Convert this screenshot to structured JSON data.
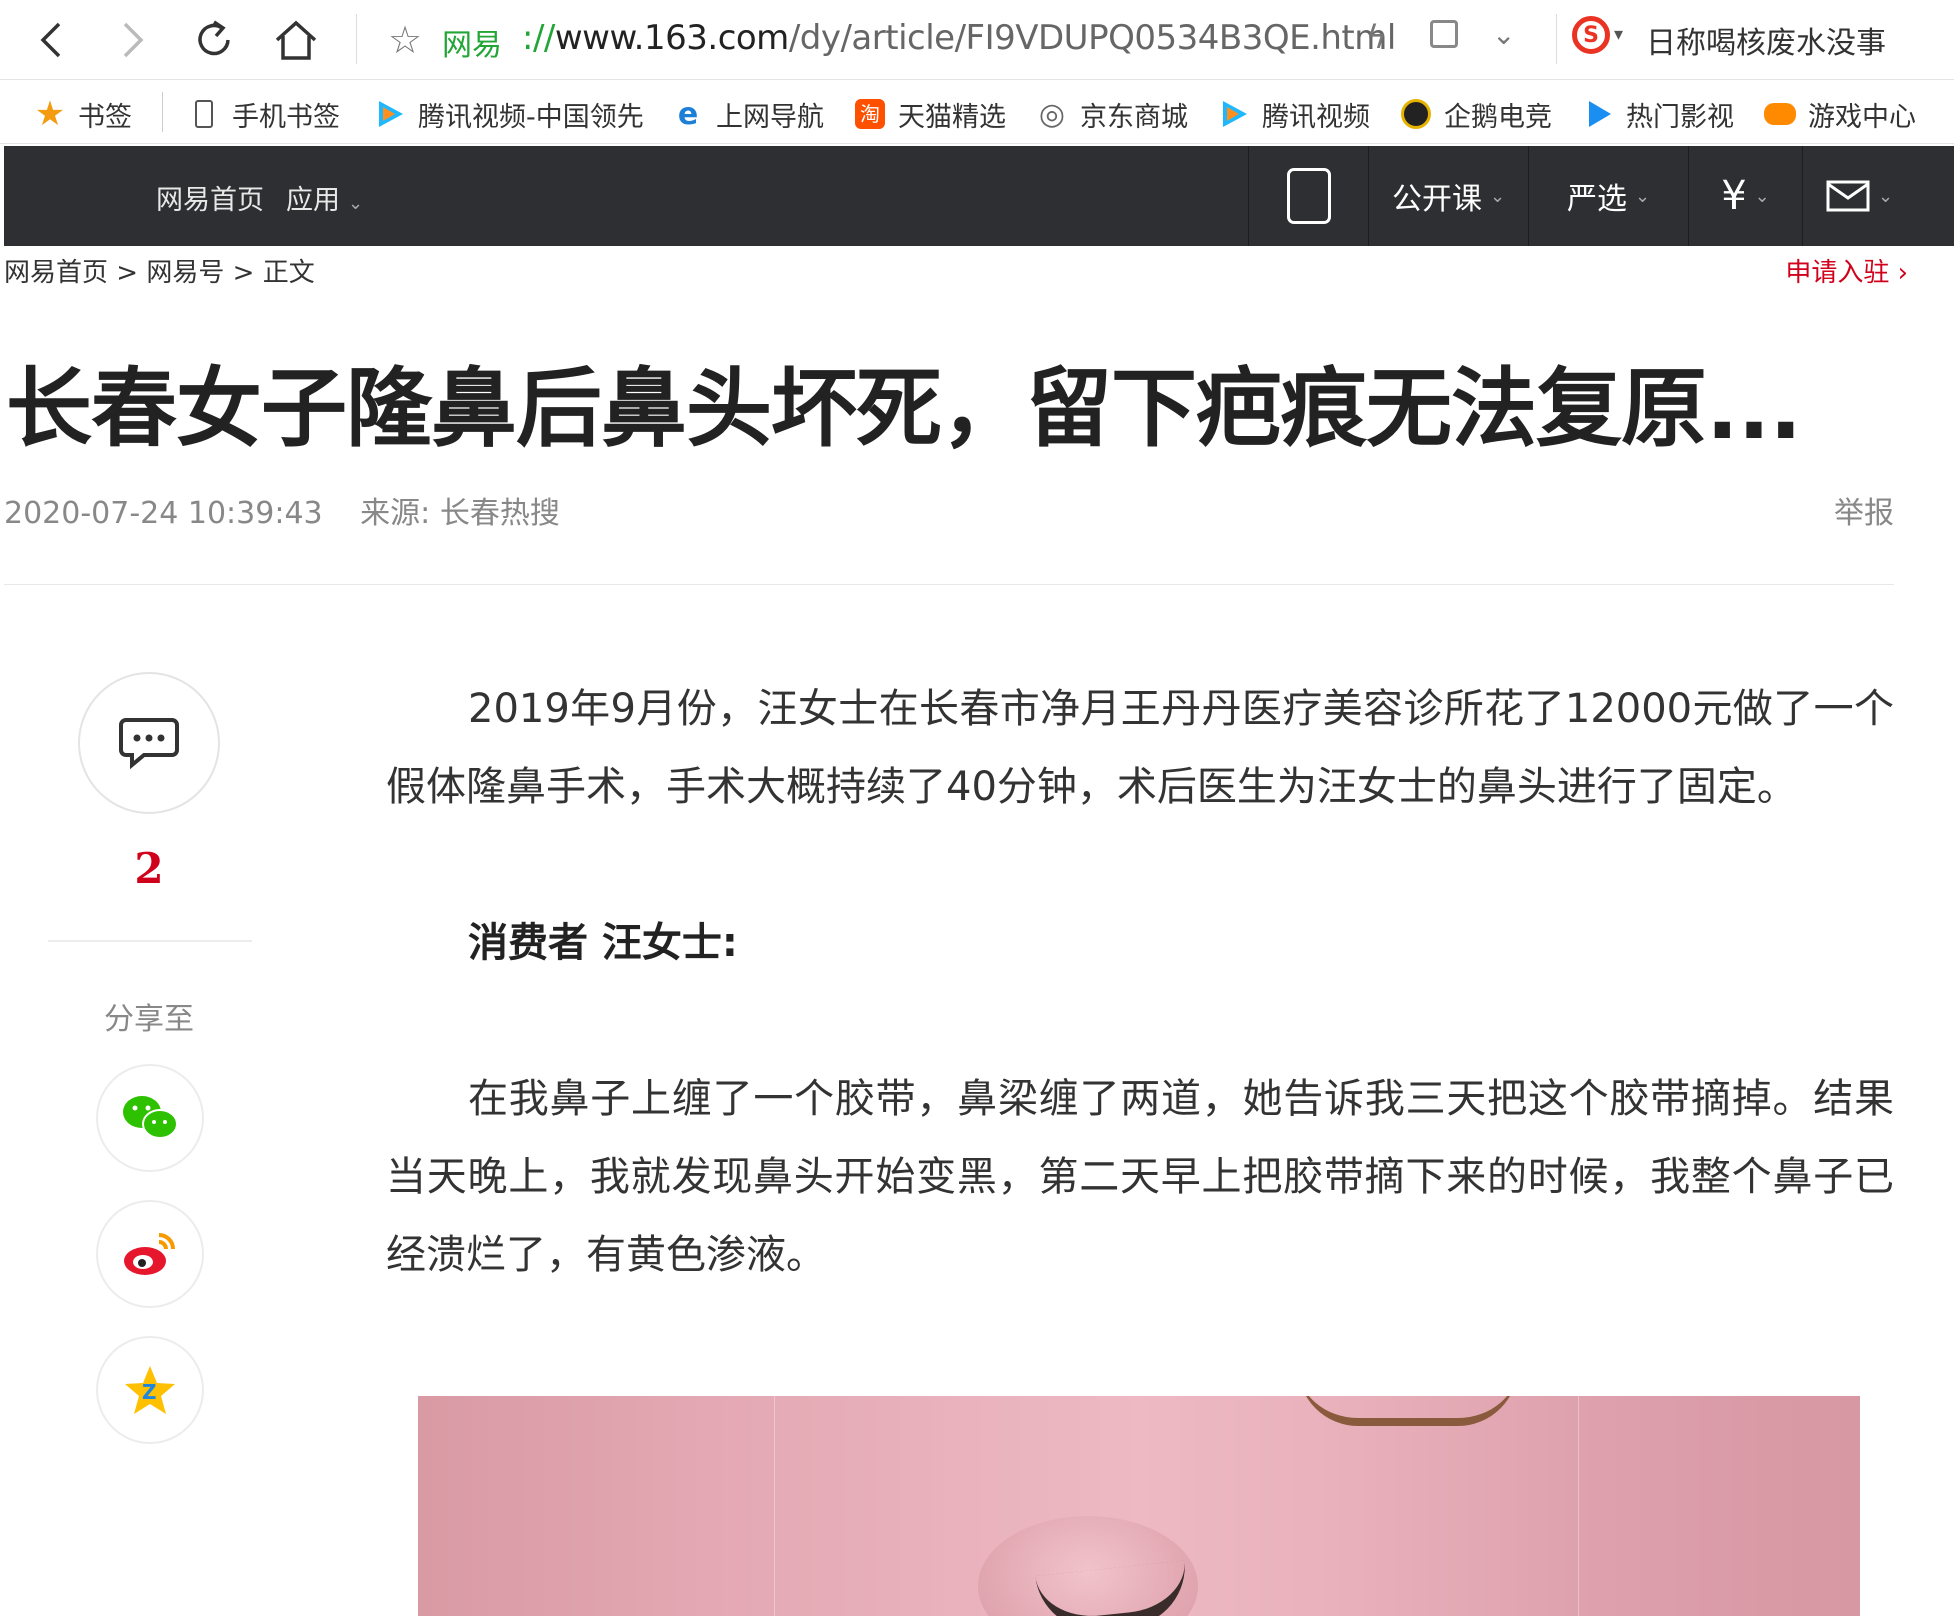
{
  "browser": {
    "url_site_label": "网易",
    "url_scheme": "://",
    "url_host": "www.163.com",
    "url_path": "/dy/article/FI9VDUPQ0534B3QE.html",
    "hot_search": "日称喝核废水没事"
  },
  "bookmarks": [
    {
      "label": "书签",
      "icon": "star-icon"
    },
    {
      "label": "手机书签",
      "icon": "phone-icon"
    },
    {
      "label": "腾讯视频-中国领先",
      "icon": "tencent-video-icon"
    },
    {
      "label": "上网导航",
      "icon": "ie-icon"
    },
    {
      "label": "天猫精选",
      "icon": "tmall-icon"
    },
    {
      "label": "京东商城",
      "icon": "globe-icon"
    },
    {
      "label": "腾讯视频",
      "icon": "tencent-video-icon"
    },
    {
      "label": "企鹅电竞",
      "icon": "penguin-icon"
    },
    {
      "label": "热门影视",
      "icon": "play-icon"
    },
    {
      "label": "游戏中心",
      "icon": "gamepad-icon"
    }
  ],
  "site_nav": {
    "home": "网易首页",
    "apps": "应用",
    "open_course": "公开课",
    "yanxuan": "严选"
  },
  "breadcrumb": {
    "home": "网易首页",
    "sep": ">",
    "channel": "网易号",
    "current": "正文"
  },
  "apply_link": "申请入驻",
  "article": {
    "title": "长春女子隆鼻后鼻头坏死，留下疤痕无法复原...",
    "datetime": "2020-07-24 10:39:43",
    "source": "来源: 长春热搜",
    "report": "举报",
    "paragraphs": [
      "2019年9月份，汪女士在长春市净月王丹丹医疗美容诊所花了12000元做了一个假体隆鼻手术，手术大概持续了40分钟，术后医生为汪女士的鼻头进行了固定。",
      "消费者 汪女士:",
      "在我鼻子上缠了一个胶带，鼻梁缠了两道，她告诉我三天把这个胶带摘掉。结果当天晚上，我就发现鼻头开始变黑，第二天早上把胶带摘下来的时候，我整个鼻子已经溃烂了，有黄色渗液。"
    ]
  },
  "sidebar": {
    "comment_count": "2",
    "share_label": "分享至"
  },
  "colors": {
    "accent_red": "#d0021b",
    "nav_bg": "#2d2f33",
    "url_green": "#23a637"
  }
}
